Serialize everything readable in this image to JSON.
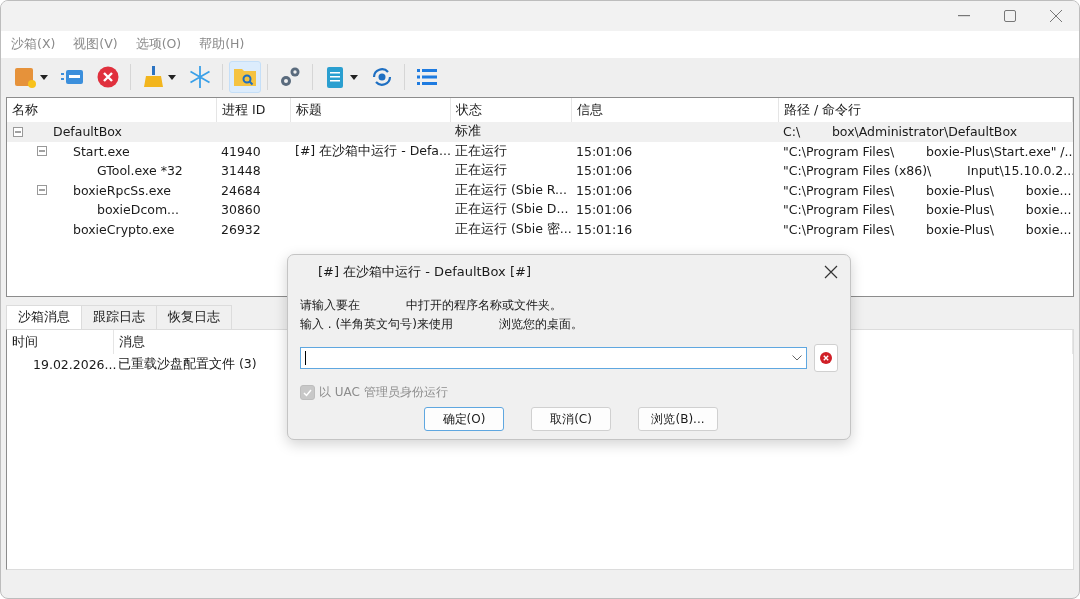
{
  "menu": [
    "沙箱(X)",
    "视图(V)",
    "选项(O)",
    "帮助(H)"
  ],
  "toolbar": [
    {
      "kind": "box",
      "dropdown": true,
      "selected": false
    },
    {
      "kind": "window",
      "selected": false
    },
    {
      "kind": "stop",
      "selected": false
    },
    {
      "kind": "sep"
    },
    {
      "kind": "broom",
      "dropdown": true,
      "selected": false
    },
    {
      "kind": "snow",
      "selected": false
    },
    {
      "kind": "sep"
    },
    {
      "kind": "folder",
      "selected": true
    },
    {
      "kind": "sep"
    },
    {
      "kind": "gears",
      "selected": false
    },
    {
      "kind": "sep"
    },
    {
      "kind": "notepad",
      "dropdown": true,
      "selected": false
    },
    {
      "kind": "sync",
      "selected": false
    },
    {
      "kind": "sep"
    },
    {
      "kind": "list",
      "selected": false
    }
  ],
  "tree": {
    "columns": [
      "名称",
      "进程 ID",
      "标题",
      "状态",
      "信息",
      "路径 / 命令行"
    ],
    "rows": [
      {
        "selected": true,
        "name": "DefaultBox",
        "status": "标准",
        "path": "C:\\        box\\Administrator\\DefaultBox",
        "expanded": true,
        "children": [
          {
            "selected": false,
            "name": "Start.exe",
            "pid": "41940",
            "title": "[#] 在沙箱中运行 - Defa...",
            "status": "正在运行",
            "info": "15:01:06",
            "path": "\"C:\\Program Files\\        boxie-Plus\\Start.exe\" /...",
            "expanded": true,
            "children": [
              {
                "selected": false,
                "name": "GTool.exe *32",
                "pid": "31448",
                "status": "正在运行",
                "info": "15:01:06",
                "path": "\"C:\\Program Files (x86)\\         Input\\15.10.0.2..."
              }
            ]
          },
          {
            "selected": false,
            "name": "boxieRpcSs.exe",
            "pid": "24684",
            "status": "正在运行 (Sbie R...",
            "info": "15:01:06",
            "path": "\"C:\\Program Files\\        boxie-Plus\\        boxie...",
            "expanded": true,
            "children": [
              {
                "selected": false,
                "name": "boxieDcom...",
                "pid": "30860",
                "status": "正在运行 (Sbie D...",
                "info": "15:01:06",
                "path": "\"C:\\Program Files\\        boxie-Plus\\        boxie..."
              }
            ]
          },
          {
            "selected": false,
            "name": "boxieCrypto.exe",
            "pid": "26932",
            "status": "正在运行 (Sbie 密...",
            "info": "15:01:16",
            "path": "\"C:\\Program Files\\        boxie-Plus\\        boxie..."
          }
        ]
      }
    ]
  },
  "log_tabs": [
    {
      "label": "沙箱消息",
      "selected": true
    },
    {
      "label": "跟踪日志",
      "selected": false
    },
    {
      "label": "恢复日志",
      "selected": false
    }
  ],
  "log": {
    "columns": [
      "时间",
      "消息"
    ],
    "rows": [
      {
        "time": "19.02.2026...",
        "message": "已重载沙盘配置文件 (3)"
      }
    ]
  },
  "dialog": {
    "title": "[#] 在沙箱中运行 - DefaultBox [#]",
    "lines": [
      "请输入要在            中打开的程序名称或文件夹。",
      "输入 . (半角英文句号)来使用            浏览您的桌面。"
    ],
    "checkbox": {
      "label": "以 UAC 管理员身份运行",
      "checked": true,
      "disabled": true
    },
    "buttons": [
      {
        "label": "确定(O)",
        "default": true
      },
      {
        "label": "取消(C)",
        "default": false
      },
      {
        "label": "浏览(B)...",
        "default": false
      }
    ]
  }
}
